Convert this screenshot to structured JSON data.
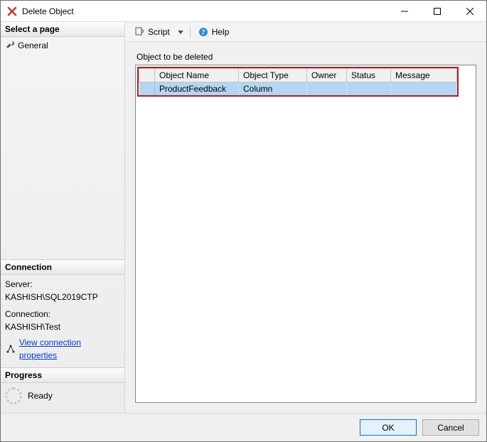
{
  "window": {
    "title": "Delete Object"
  },
  "sidebar": {
    "select_page_header": "Select a page",
    "pages": [
      {
        "label": "General"
      }
    ],
    "connection_header": "Connection",
    "connection": {
      "server_label": "Server:",
      "server_value": "KASHISH\\SQL2019CTP",
      "connection_label": "Connection:",
      "connection_value": "KASHISH\\Test",
      "link_text": "View connection properties"
    },
    "progress_header": "Progress",
    "progress_status": "Ready"
  },
  "toolbar": {
    "script_label": "Script",
    "help_label": "Help"
  },
  "content": {
    "section_label": "Object to be deleted",
    "columns": {
      "name": "Object Name",
      "type": "Object Type",
      "owner": "Owner",
      "status": "Status",
      "message": "Message"
    },
    "rows": [
      {
        "name": "ProductFeedback",
        "type": "Column",
        "owner": "",
        "status": "",
        "message": ""
      }
    ]
  },
  "footer": {
    "ok": "OK",
    "cancel": "Cancel"
  }
}
